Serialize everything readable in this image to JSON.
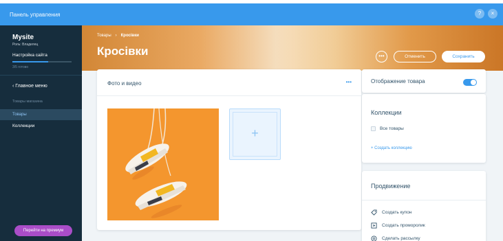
{
  "topbar": {
    "title": "Панель управления",
    "help": "?",
    "close": "×"
  },
  "sidebar": {
    "site_name": "Mysite",
    "owner": "Роль: Владелец",
    "setup_label": "Настройка сайта",
    "setup_progress": 0.6,
    "setup_steps": "3/5 готово",
    "main_menu": "‹  Главное меню",
    "store_products": "Товары магазина",
    "products": "Товары",
    "collections": "Коллекции",
    "premium": "Перейти на премиум"
  },
  "header": {
    "breadcrumb": [
      "Товары",
      "›",
      "Кросівки"
    ],
    "title": "Кросівки",
    "more": "•••",
    "cancel": "Отменить",
    "save": "Сохранить"
  },
  "media": {
    "title": "Фото и видео",
    "more": "•••"
  },
  "visibility": {
    "title": "Отображение товара",
    "enabled": true
  },
  "collections": {
    "title": "Коллекции",
    "items": [
      "Все товары"
    ],
    "create": "+ Создать коллекцию"
  },
  "promotion": {
    "title": "Продвижение",
    "items": [
      "Создать купон",
      "Создать проморолик",
      "Сделать рассылку"
    ]
  },
  "colors": {
    "accent": "#3899ec",
    "sidebar": "#162d3d",
    "premium": "#aa4dc8",
    "photo_bg": "#f4962e"
  }
}
